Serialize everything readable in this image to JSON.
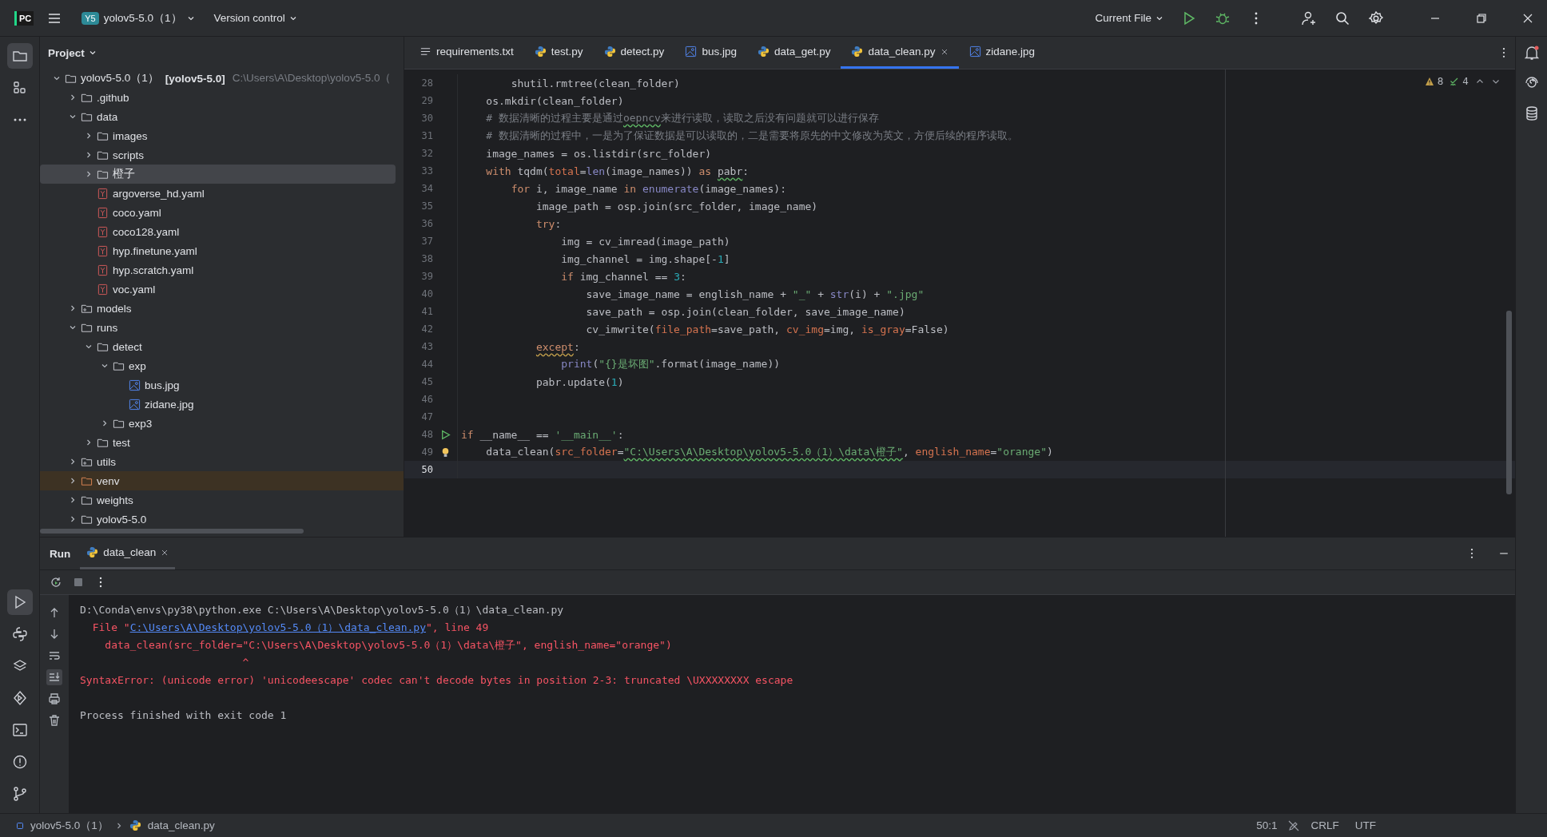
{
  "title_bar": {
    "logo": "PC",
    "project_badge": "Y5",
    "project": "yolov5-5.0（1）",
    "vcs": "Version control",
    "run_config": "Current File"
  },
  "tool_strip": {
    "top": [
      {
        "kind": "folder",
        "selected": true
      },
      {
        "kind": "structure",
        "selected": false
      },
      {
        "kind": "more",
        "selected": false
      }
    ],
    "bottom": [
      {
        "kind": "run",
        "selected": true
      },
      {
        "kind": "python",
        "selected": false
      },
      {
        "kind": "layers",
        "selected": false
      },
      {
        "kind": "services",
        "selected": false
      },
      {
        "kind": "terminal",
        "selected": false
      },
      {
        "kind": "problems",
        "selected": false
      },
      {
        "kind": "git",
        "selected": false
      }
    ]
  },
  "project": {
    "title": "Project",
    "tree": [
      {
        "name": "yolov5-5.0（1）",
        "module": "[yolov5-5.0]",
        "path": "C:\\Users\\A\\Desktop\\yolov5-5.0（",
        "kind": "folder",
        "expanded": true,
        "selected": false,
        "children": [
          {
            "name": ".github",
            "kind": "folder",
            "expanded": false,
            "selected": false
          },
          {
            "name": "data",
            "kind": "folder",
            "expanded": true,
            "selected": false,
            "children": [
              {
                "name": "images",
                "kind": "folder",
                "expanded": false,
                "selected": false
              },
              {
                "name": "scripts",
                "kind": "folder",
                "expanded": false,
                "selected": false
              },
              {
                "name": "橙子",
                "kind": "folder",
                "expanded": false,
                "selected": true
              },
              {
                "name": "argoverse_hd.yaml",
                "kind": "yaml",
                "selected": false
              },
              {
                "name": "coco.yaml",
                "kind": "yaml",
                "selected": false
              },
              {
                "name": "coco128.yaml",
                "kind": "yaml",
                "selected": false
              },
              {
                "name": "hyp.finetune.yaml",
                "kind": "yaml",
                "selected": false
              },
              {
                "name": "hyp.scratch.yaml",
                "kind": "yaml",
                "selected": false
              },
              {
                "name": "voc.yaml",
                "kind": "yaml",
                "selected": false
              }
            ]
          },
          {
            "name": "models",
            "kind": "package",
            "expanded": false,
            "selected": false
          },
          {
            "name": "runs",
            "kind": "folder",
            "expanded": true,
            "selected": false,
            "children": [
              {
                "name": "detect",
                "kind": "folder",
                "expanded": true,
                "selected": false,
                "children": [
                  {
                    "name": "exp",
                    "kind": "folder",
                    "expanded": true,
                    "selected": false,
                    "children": [
                      {
                        "name": "bus.jpg",
                        "kind": "image",
                        "selected": false
                      },
                      {
                        "name": "zidane.jpg",
                        "kind": "image",
                        "selected": false
                      }
                    ]
                  },
                  {
                    "name": "exp3",
                    "kind": "folder",
                    "expanded": false,
                    "selected": false
                  }
                ]
              },
              {
                "name": "test",
                "kind": "folder",
                "expanded": false,
                "selected": false
              }
            ]
          },
          {
            "name": "utils",
            "kind": "package",
            "expanded": false,
            "selected": false
          },
          {
            "name": "venv",
            "kind": "excluded",
            "expanded": false,
            "selected": false
          },
          {
            "name": "weights",
            "kind": "folder",
            "expanded": false,
            "selected": false
          },
          {
            "name": "yolov5-5.0",
            "kind": "folder",
            "expanded": false,
            "selected": false
          }
        ]
      }
    ]
  },
  "tabs": [
    {
      "label": "requirements.txt",
      "kind": "text",
      "selected": false
    },
    {
      "label": "test.py",
      "kind": "python",
      "selected": false
    },
    {
      "label": "detect.py",
      "kind": "python",
      "selected": false
    },
    {
      "label": "bus.jpg",
      "kind": "image",
      "selected": false
    },
    {
      "label": "data_get.py",
      "kind": "python",
      "selected": false
    },
    {
      "label": "data_clean.py",
      "kind": "python",
      "selected": true
    },
    {
      "label": "zidane.jpg",
      "kind": "image",
      "selected": false
    }
  ],
  "inspections": {
    "warnings": "8",
    "typos": "4"
  },
  "editor": {
    "lines": [
      {
        "number": "28",
        "current": false,
        "tokens": [
          {
            "text": "        shutil.rmtree(clean_folder)",
            "kind": "plain"
          }
        ]
      },
      {
        "number": "29",
        "current": false,
        "tokens": [
          {
            "text": "    os.mkdir(clean_folder)",
            "kind": "plain"
          }
        ]
      },
      {
        "number": "30",
        "current": false,
        "tokens": [
          {
            "text": "    # 数据清晰的过程主要是通过",
            "kind": "comment"
          },
          {
            "text": "oepncv",
            "kind": "comment-typo"
          },
          {
            "text": "来进行读取，读取之后没有问题就可以进行保存",
            "kind": "comment"
          }
        ]
      },
      {
        "number": "31",
        "current": false,
        "tokens": [
          {
            "text": "    # 数据清晰的过程中，一是为了保证数据是可以读取的，二是需要将原先的中文修改为英文，方便后续的程序读取。",
            "kind": "comment"
          }
        ]
      },
      {
        "number": "32",
        "current": false,
        "tokens": [
          {
            "text": "    image_names = os.listdir(src_folder)",
            "kind": "plain"
          }
        ]
      },
      {
        "number": "33",
        "current": false,
        "tokens": [
          {
            "text": "    with",
            "kind": "kw"
          },
          {
            "text": " tqdm(",
            "kind": "plain"
          },
          {
            "text": "total",
            "kind": "param"
          },
          {
            "text": "=",
            "kind": "plain"
          },
          {
            "text": "len",
            "kind": "fn"
          },
          {
            "text": "(image_names)) ",
            "kind": "plain"
          },
          {
            "text": "as ",
            "kind": "kw"
          },
          {
            "text": "pabr",
            "kind": "typo"
          },
          {
            "text": ":",
            "kind": "plain"
          }
        ]
      },
      {
        "number": "34",
        "current": false,
        "tokens": [
          {
            "text": "        for",
            "kind": "kw"
          },
          {
            "text": " i, image_name ",
            "kind": "plain"
          },
          {
            "text": "in ",
            "kind": "kw"
          },
          {
            "text": "enumerate",
            "kind": "fn"
          },
          {
            "text": "(image_names):",
            "kind": "plain"
          }
        ]
      },
      {
        "number": "35",
        "current": false,
        "tokens": [
          {
            "text": "            image_path = osp.join(src_folder, image_name)",
            "kind": "plain"
          }
        ]
      },
      {
        "number": "36",
        "current": false,
        "tokens": [
          {
            "text": "            try",
            "kind": "kw"
          },
          {
            "text": ":",
            "kind": "plain"
          }
        ]
      },
      {
        "number": "37",
        "current": false,
        "tokens": [
          {
            "text": "                img = cv_imread(image_path)",
            "kind": "plain"
          }
        ]
      },
      {
        "number": "38",
        "current": false,
        "tokens": [
          {
            "text": "                img_channel = img.shape[-",
            "kind": "plain"
          },
          {
            "text": "1",
            "kind": "num"
          },
          {
            "text": "]",
            "kind": "plain"
          }
        ]
      },
      {
        "number": "39",
        "current": false,
        "tokens": [
          {
            "text": "                if",
            "kind": "kw"
          },
          {
            "text": " img_channel == ",
            "kind": "plain"
          },
          {
            "text": "3",
            "kind": "num"
          },
          {
            "text": ":",
            "kind": "plain"
          }
        ]
      },
      {
        "number": "40",
        "current": false,
        "tokens": [
          {
            "text": "                    save_image_name = english_name + ",
            "kind": "plain"
          },
          {
            "text": "\"_\"",
            "kind": "str"
          },
          {
            "text": " + ",
            "kind": "plain"
          },
          {
            "text": "str",
            "kind": "fn"
          },
          {
            "text": "(i) + ",
            "kind": "plain"
          },
          {
            "text": "\".jpg\"",
            "kind": "str"
          }
        ]
      },
      {
        "number": "41",
        "current": false,
        "tokens": [
          {
            "text": "                    save_path = osp.join(clean_folder, save_image_name)",
            "kind": "plain"
          }
        ]
      },
      {
        "number": "42",
        "current": false,
        "tokens": [
          {
            "text": "                    cv_imwrite(",
            "kind": "plain"
          },
          {
            "text": "file_path",
            "kind": "param"
          },
          {
            "text": "=save_path, ",
            "kind": "plain"
          },
          {
            "text": "cv_img",
            "kind": "param"
          },
          {
            "text": "=img, ",
            "kind": "plain"
          },
          {
            "text": "is_gray",
            "kind": "param"
          },
          {
            "text": "=False)",
            "kind": "plain"
          }
        ]
      },
      {
        "number": "43",
        "current": false,
        "tokens": [
          {
            "text": "            except",
            "kind": "kw-typo"
          },
          {
            "text": ":",
            "kind": "plain"
          }
        ]
      },
      {
        "number": "44",
        "current": false,
        "tokens": [
          {
            "text": "                print",
            "kind": "fn"
          },
          {
            "text": "(",
            "kind": "plain"
          },
          {
            "text": "\"{}是坏图\"",
            "kind": "str"
          },
          {
            "text": ".format(image_name))",
            "kind": "plain"
          }
        ]
      },
      {
        "number": "45",
        "current": false,
        "tokens": [
          {
            "text": "            pabr.update(",
            "kind": "plain"
          },
          {
            "text": "1",
            "kind": "num"
          },
          {
            "text": ")",
            "kind": "plain"
          }
        ]
      },
      {
        "number": "46",
        "current": false
      },
      {
        "number": "47",
        "current": false
      },
      {
        "number": "48",
        "current": false,
        "kind": "run",
        "tokens": [
          {
            "text": "if",
            "kind": "kw"
          },
          {
            "text": " __name__ == ",
            "kind": "plain"
          },
          {
            "text": "'__main__'",
            "kind": "str"
          },
          {
            "text": ":",
            "kind": "plain"
          }
        ]
      },
      {
        "number": "49",
        "current": false,
        "kind": "bulb",
        "tokens": [
          {
            "text": "    data_clean(",
            "kind": "plain"
          },
          {
            "text": "src_folder",
            "kind": "param"
          },
          {
            "text": "=",
            "kind": "plain"
          },
          {
            "text": "\"C:\\Users\\A\\Desktop\\yolov5-5.0（1）\\data\\橙子\"",
            "kind": "str-typo"
          },
          {
            "text": ", ",
            "kind": "plain"
          },
          {
            "text": "english_name",
            "kind": "param"
          },
          {
            "text": "=",
            "kind": "plain"
          },
          {
            "text": "\"orange\"",
            "kind": "str"
          },
          {
            "text": ")",
            "kind": "plain"
          }
        ]
      },
      {
        "number": "50",
        "current": true
      }
    ]
  },
  "run_panel": {
    "title": "Run",
    "tab": "data_clean",
    "lines": [
      [
        {
          "text": "D:\\Conda\\envs\\py38\\python.exe C:\\Users\\A\\Desktop\\yolov5-5.0（1）\\data_clean.py",
          "kind": "plain"
        }
      ],
      [
        {
          "text": "  File \"",
          "kind": "error"
        },
        {
          "text": "C:\\Users\\A\\Desktop\\yolov5-5.0（1）\\data_clean.py",
          "kind": "link"
        },
        {
          "text": "\", line 49",
          "kind": "error"
        }
      ],
      [
        {
          "text": "    data_clean(src_folder=\"C:\\Users\\A\\Desktop\\yolov5-5.0（1）\\data\\橙子\", english_name=\"orange\")",
          "kind": "error"
        }
      ],
      [
        {
          "text": "                          ^",
          "kind": "error"
        }
      ],
      [
        {
          "text": "SyntaxError: (unicode error) 'unicodeescape' codec can't decode bytes in position 2-3: truncated \\UXXXXXXXX escape",
          "kind": "error"
        }
      ]
    ],
    "exit_message": "Process finished with exit code 1"
  },
  "status_bar": {
    "breadcrumb": [
      "yolov5-5.0（1）",
      "data_clean.py"
    ],
    "position": "50:1",
    "line_separator": "CRLF",
    "encoding": "UTF"
  }
}
